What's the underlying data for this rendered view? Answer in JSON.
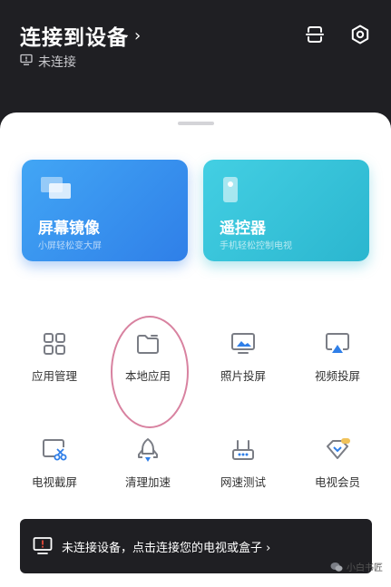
{
  "header": {
    "title": "连接到设备",
    "chevron": "›",
    "status": "未连接",
    "status_icon": "monitor-icon",
    "actions": [
      "scan-icon",
      "settings-gear-icon"
    ]
  },
  "cards": [
    {
      "title": "屏幕镜像",
      "subtitle": "小屏轻松变大屏",
      "icon": "screen-mirror-icon",
      "color_from": "#42a6f5",
      "color_to": "#2f7fe8"
    },
    {
      "title": "遥控器",
      "subtitle": "手机轻松控制电视",
      "icon": "remote-icon",
      "color_from": "#43cfe3",
      "color_to": "#2bb6cf"
    }
  ],
  "grid": [
    {
      "label": "应用管理",
      "icon": "app-grid-icon"
    },
    {
      "label": "本地应用",
      "icon": "folder-icon"
    },
    {
      "label": "照片投屏",
      "icon": "photo-cast-icon"
    },
    {
      "label": "视频投屏",
      "icon": "video-cast-icon"
    },
    {
      "label": "电视截屏",
      "icon": "screenshot-scissors-icon"
    },
    {
      "label": "清理加速",
      "icon": "rocket-icon"
    },
    {
      "label": "网速测试",
      "icon": "router-icon"
    },
    {
      "label": "电视会员",
      "icon": "vip-diamond-icon"
    }
  ],
  "banner": {
    "text": "未连接设备，点击连接您的电视或盒子 ›",
    "icon": "tv-alert-icon"
  },
  "watermark": "小白书匠",
  "colors": {
    "dark": "#1f1f23",
    "accent_blue": "#2f7fe8",
    "accent_cyan": "#2bb6cf",
    "icon_gray": "#7a7d85",
    "highlight_circle": "#d882a0"
  }
}
